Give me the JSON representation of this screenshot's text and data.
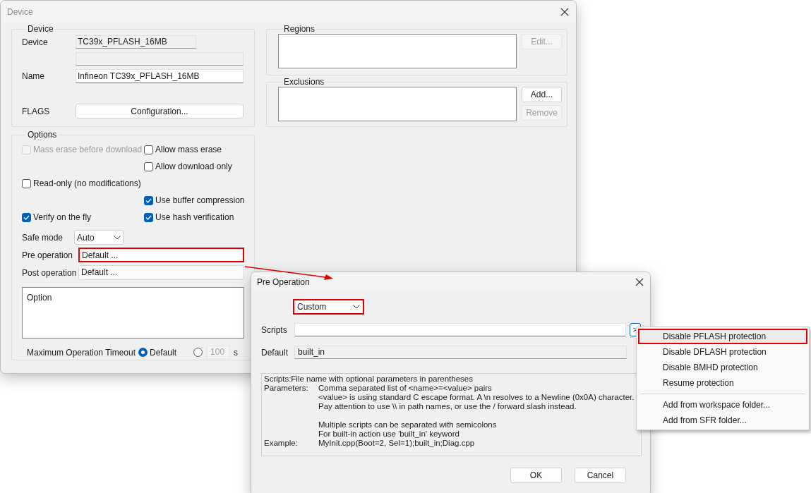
{
  "device_dialog": {
    "title": "Device",
    "device_group": {
      "title": "Device",
      "rows": [
        {
          "kind": "readonly",
          "label": "Device",
          "value": "TC39x_PFLASH_16MB"
        },
        {
          "kind": "readonly-wide"
        },
        {
          "kind": "input",
          "label": "Name",
          "value": "Infineon TC39x_PFLASH_16MB"
        },
        {
          "kind": "button",
          "label": "FLAGS",
          "value": "Configuration..."
        }
      ]
    },
    "regions_group": {
      "title": "Regions",
      "buttons": [
        {
          "label": "Edit...",
          "disabled": true
        }
      ]
    },
    "exclusions_group": {
      "title": "Exclusions",
      "buttons": [
        {
          "label": "Add...",
          "disabled": false
        },
        {
          "label": "Remove",
          "disabled": true
        }
      ]
    },
    "options_group": {
      "title": "Options",
      "checkbox_rows": [
        {
          "left": {
            "label": "Mass erase before download",
            "checked": false,
            "disabled": true
          },
          "right": {
            "label": "Allow mass erase",
            "checked": false,
            "disabled": false
          }
        },
        {
          "right": {
            "label": "Allow download only",
            "checked": false,
            "disabled": false
          }
        },
        {
          "left": {
            "label": "Read-only (no modifications)",
            "checked": false,
            "disabled": false
          }
        },
        {
          "right": {
            "label": "Use buffer compression",
            "checked": true,
            "disabled": false
          }
        },
        {
          "left": {
            "label": "Verify on the fly",
            "checked": true,
            "disabled": false
          },
          "right": {
            "label": "Use hash verification",
            "checked": true,
            "disabled": false
          }
        }
      ],
      "safe_mode": {
        "label": "Safe mode",
        "value": "Auto"
      },
      "operations": [
        {
          "label": "Pre operation",
          "value": "Default ...",
          "highlighted": true
        },
        {
          "label": "Post operation",
          "value": "Default ...",
          "highlighted": false
        }
      ],
      "option_box": {
        "text": "Option"
      },
      "timeout": {
        "label": "Maximum Operation Timeout",
        "default_option": {
          "label": "Default",
          "selected": true
        },
        "custom_option": {
          "selected": false,
          "value": "100",
          "unit": "s"
        }
      }
    }
  },
  "pre_operation_dialog": {
    "title": "Pre Operation",
    "mode": {
      "value": "Custom",
      "highlighted": true
    },
    "scripts": {
      "label": "Scripts",
      "browse": ">"
    },
    "default": {
      "label": "Default",
      "value": "built_in"
    },
    "help": {
      "intro": "Scripts:File name with optional parameters in parentheses",
      "sections": [
        {
          "label": "Parameters:",
          "paragraphs": [
            [
              "Comma separated list of <name>=<value> pairs",
              "<value> is using standard C escape format. A \\n resolves to a Newline (0x0A) character.",
              "Pay attention to use \\\\ in path names, or use the / forward slash instead."
            ],
            [
              "Multiple scripts can be separated with semicolons",
              "For built-in action use 'built_in' keyword"
            ]
          ]
        },
        {
          "label": "Example:",
          "paragraphs": [
            [
              "MyInit.cpp(Boot=2, Sel=1);built_in;Diag.cpp"
            ]
          ]
        }
      ]
    },
    "buttons": [
      "OK",
      "Cancel"
    ]
  },
  "script_menu": {
    "items": [
      {
        "kind": "item",
        "label": "Disable PFLASH protection",
        "highlighted": true
      },
      {
        "kind": "item",
        "label": "Disable DFLASH protection",
        "highlighted": false
      },
      {
        "kind": "item",
        "label": "Disable BMHD protection",
        "highlighted": false
      },
      {
        "kind": "item",
        "label": "Resume protection",
        "highlighted": false
      },
      {
        "kind": "separator"
      },
      {
        "kind": "item",
        "label": "Add from workspace folder...",
        "highlighted": false
      },
      {
        "kind": "item",
        "label": "Add from SFR folder...",
        "highlighted": false
      }
    ]
  }
}
